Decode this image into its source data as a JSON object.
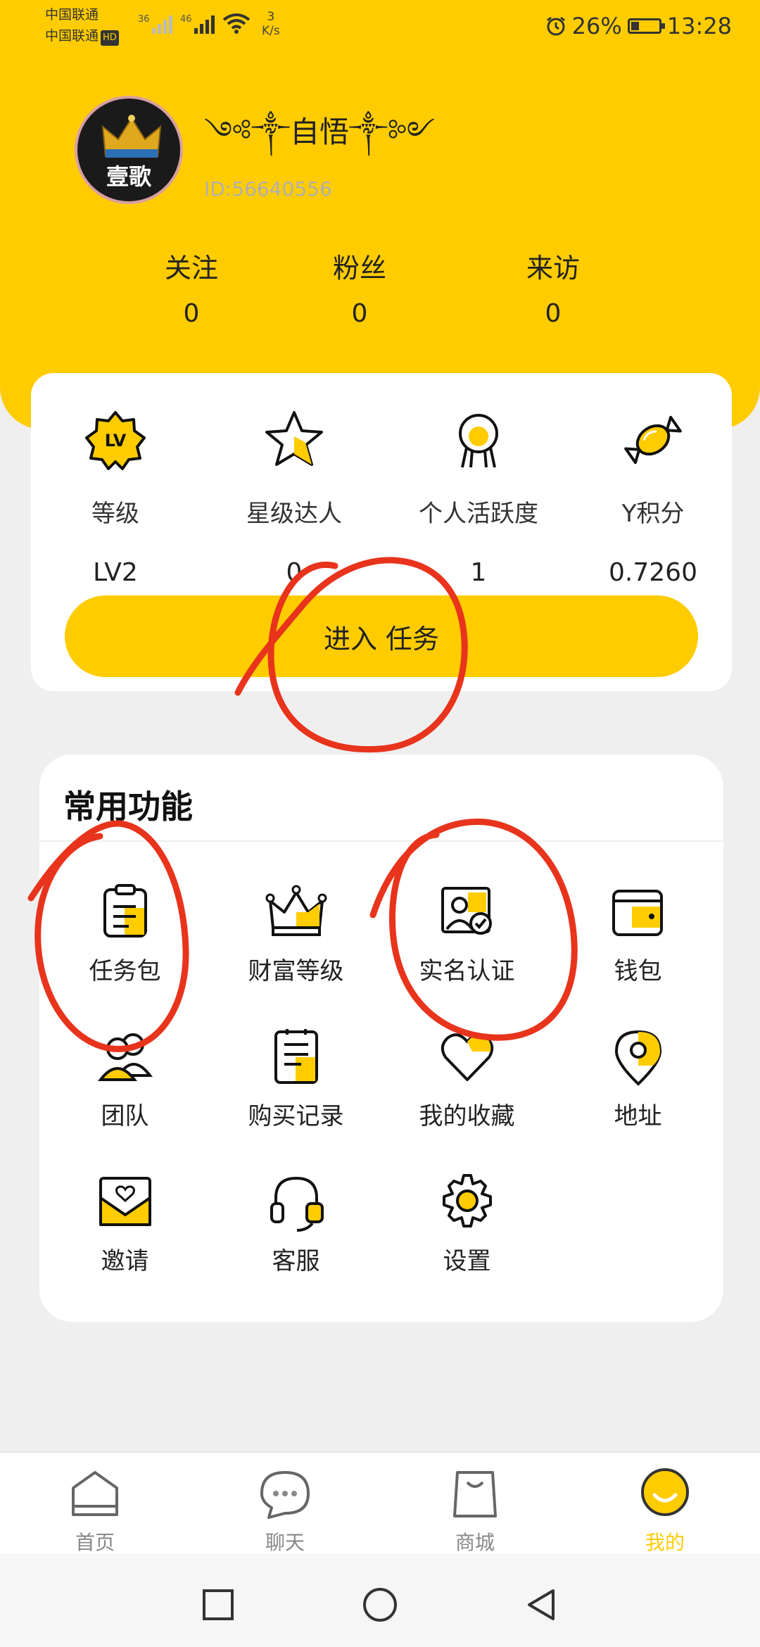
{
  "status_bar": {
    "carrier1": "中国联通",
    "carrier2": "中国联通",
    "hd": "HD",
    "signal1": "36",
    "signal2": "46",
    "speed_value": "3",
    "speed_unit": "K/s",
    "battery_percent": "26%",
    "battery_level": 0.26,
    "time": "13:28",
    "icons": [
      "alarm-icon",
      "wifi-icon",
      "signal-icon",
      "battery-icon"
    ]
  },
  "profile": {
    "avatar_text": "壹歌",
    "nickname": "༺༒自悟༒༻",
    "user_id": "ID:56640556"
  },
  "stats": [
    {
      "label": "关注",
      "value": "0"
    },
    {
      "label": "粉丝",
      "value": "0"
    },
    {
      "label": "来访",
      "value": "0"
    }
  ],
  "levels": [
    {
      "label": "等级",
      "value": "LV2",
      "icon": "lv-badge-icon"
    },
    {
      "label": "星级达人",
      "value": "0",
      "icon": "star-icon"
    },
    {
      "label": "个人活跃度",
      "value": "1",
      "icon": "activity-icon"
    },
    {
      "label": "Y积分",
      "value": "0.7260",
      "icon": "candy-icon"
    }
  ],
  "task_button": "进入 任务",
  "common_functions": {
    "title": "常用功能",
    "items": [
      {
        "label": "任务包",
        "icon": "clipboard-icon"
      },
      {
        "label": "财富等级",
        "icon": "crown-icon"
      },
      {
        "label": "实名认证",
        "icon": "id-verify-icon"
      },
      {
        "label": "钱包",
        "icon": "wallet-icon"
      },
      {
        "label": "团队",
        "icon": "team-icon"
      },
      {
        "label": "购买记录",
        "icon": "purchase-record-icon"
      },
      {
        "label": "我的收藏",
        "icon": "favorite-icon"
      },
      {
        "label": "地址",
        "icon": "location-icon"
      },
      {
        "label": "邀请",
        "icon": "invite-icon"
      },
      {
        "label": "客服",
        "icon": "headset-icon"
      },
      {
        "label": "设置",
        "icon": "gear-icon"
      }
    ]
  },
  "bottom_nav": [
    {
      "label": "首页",
      "icon": "home-icon",
      "active": false
    },
    {
      "label": "聊天",
      "icon": "chat-icon",
      "active": false
    },
    {
      "label": "商城",
      "icon": "shop-bag-icon",
      "active": false
    },
    {
      "label": "我的",
      "icon": "me-icon",
      "active": true
    }
  ],
  "colors": {
    "accent": "#ffcc00",
    "annotation": "#e8341c"
  }
}
